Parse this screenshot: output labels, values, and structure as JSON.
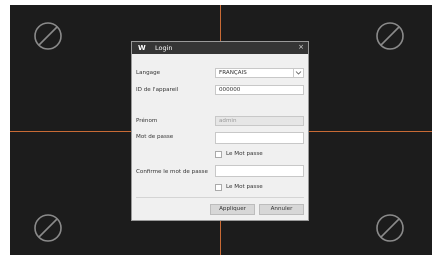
{
  "dialog": {
    "logo_text": "W",
    "title": "Login",
    "close_glyph": "×",
    "language_label": "Langage",
    "language_value": "FRANÇAIS",
    "device_id_label": "ID de l'appareil",
    "device_id_value": "000000",
    "first_name_label": "Prénom",
    "first_name_value": "admin",
    "password_label": "Mot de passe",
    "password_value": "",
    "show_password_label": "Le Mot passe",
    "confirm_label": "Confirme le mot de passe",
    "confirm_value": "",
    "show_confirm_label": "Le Mot passe",
    "apply_label": "Appliquer",
    "cancel_label": "Annuler"
  },
  "colors": {
    "grid_line": "#c86a35",
    "screen_bg": "#1a1a1a",
    "titlebar_bg": "#353535",
    "dialog_bg": "#f0f0f0"
  },
  "icons": {
    "camera_placeholder": "no-video-icon",
    "dropdown": "chevron-down-icon"
  }
}
